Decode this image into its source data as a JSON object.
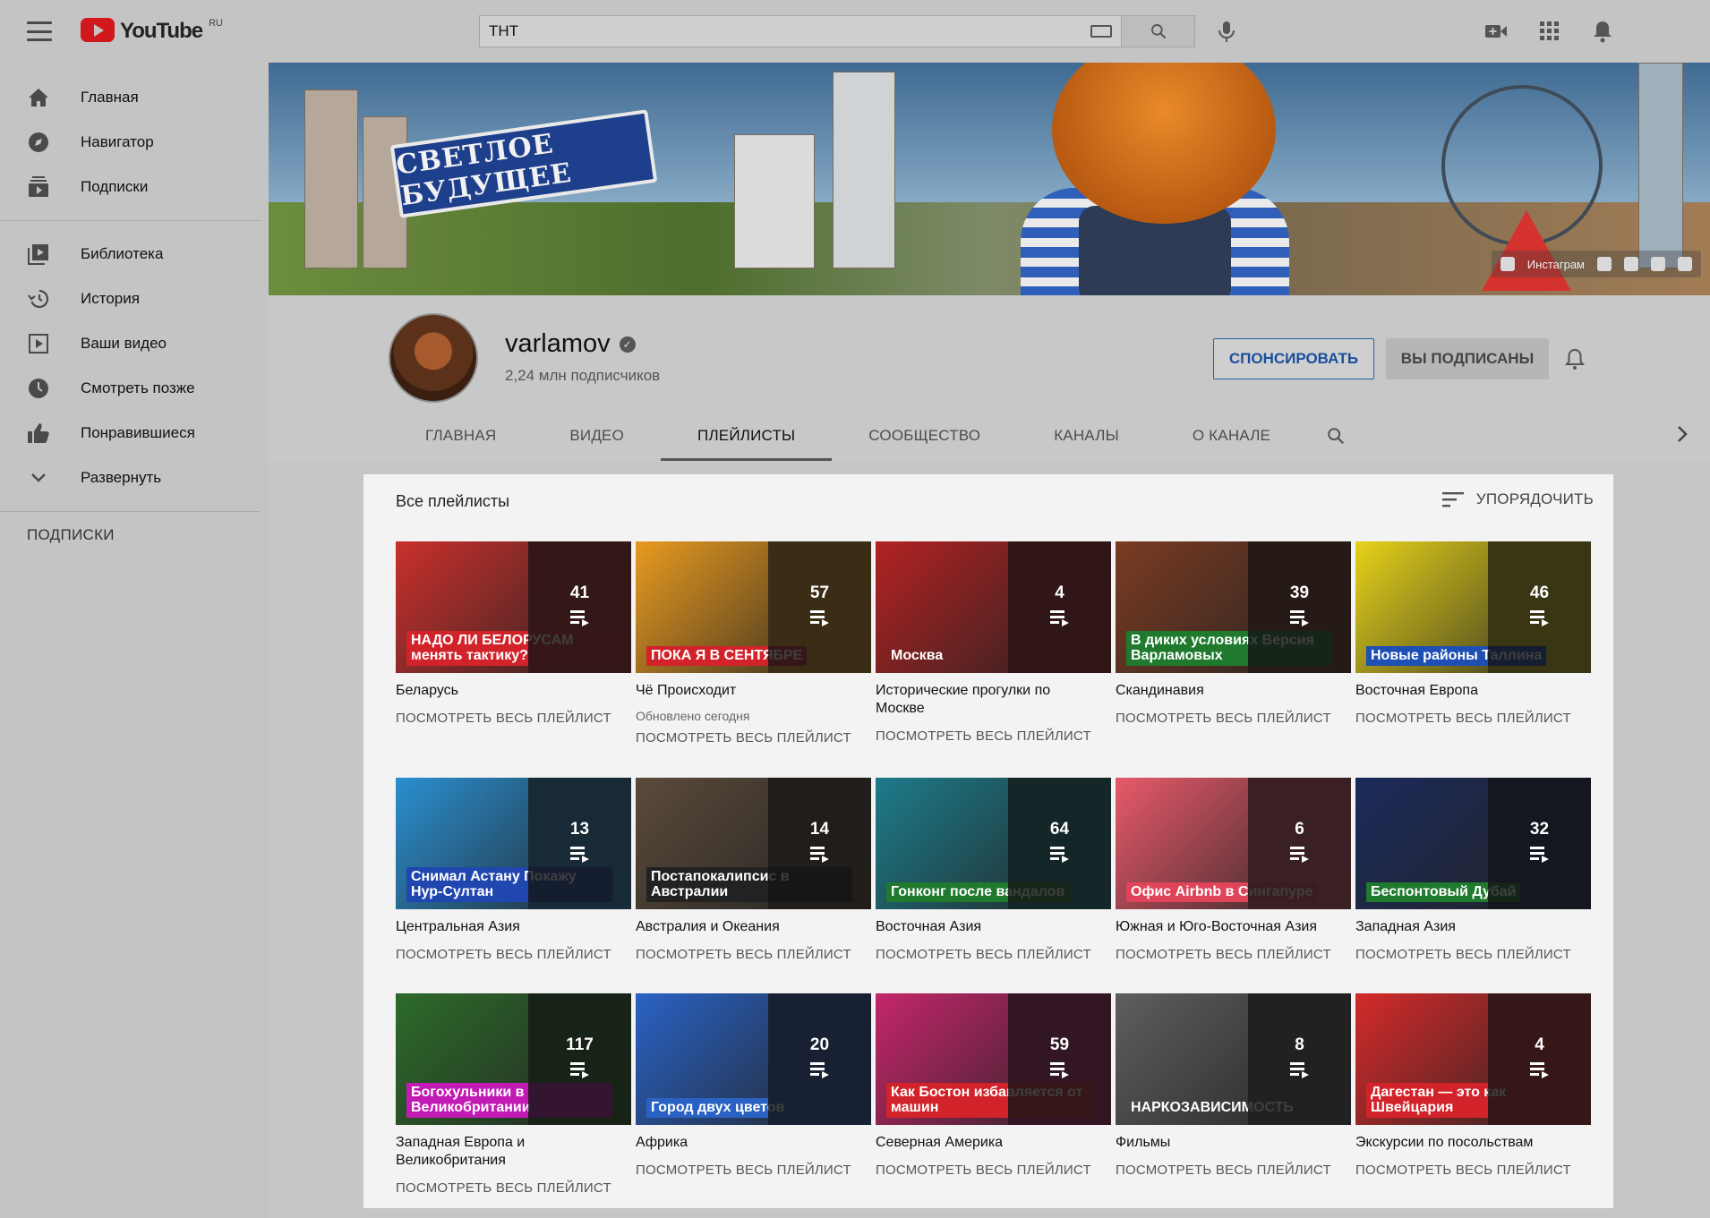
{
  "topbar": {
    "logo_text": "YouTube",
    "logo_region": "RU",
    "search_value": "ТНТ"
  },
  "sidebar": {
    "items": [
      {
        "label": "Главная",
        "icon": "home-icon"
      },
      {
        "label": "Навигатор",
        "icon": "compass-icon"
      },
      {
        "label": "Подписки",
        "icon": "subscriptions-icon"
      },
      {
        "label": "Библиотека",
        "icon": "library-icon"
      },
      {
        "label": "История",
        "icon": "history-icon"
      },
      {
        "label": "Ваши видео",
        "icon": "your-videos-icon"
      },
      {
        "label": "Смотреть позже",
        "icon": "clock-icon"
      },
      {
        "label": "Понравившиеся",
        "icon": "thumbs-up-icon"
      },
      {
        "label": "Развернуть",
        "icon": "chevron-down-icon"
      }
    ],
    "subscriptions_header": "ПОДПИСКИ"
  },
  "banner": {
    "sign_text": "СВЕТЛОЕ БУДУЩЕЕ",
    "social_label": "Инстаграм"
  },
  "channel": {
    "name": "varlamov",
    "subscribers": "2,24 млн подписчиков",
    "sponsor_label": "СПОНСИРОВАТЬ",
    "subscribed_label": "ВЫ ПОДПИСАНЫ",
    "tabs": [
      "ГЛАВНАЯ",
      "ВИДЕО",
      "ПЛЕЙЛИСТЫ",
      "СООБЩЕСТВО",
      "КАНАЛЫ",
      "О КАНАЛЕ"
    ],
    "active_tab": "ПЛЕЙЛИСТЫ"
  },
  "playlists": {
    "section_title": "Все плейлисты",
    "sort_label": "УПОРЯДОЧИТЬ",
    "view_all_label": "ПОСМОТРЕТЬ ВЕСЬ ПЛЕЙЛИСТ",
    "items": [
      {
        "title": "Беларусь",
        "count": "41",
        "caption": "НАДО ЛИ БЕЛОРУСАМ менять тактику?",
        "color": "#c9302c",
        "cap_bg": "#d3232a"
      },
      {
        "title": "Чё Происходит",
        "count": "57",
        "caption": "ПОКА Я В СЕНТЯБРЕ",
        "updated": "Обновлено сегодня",
        "color": "#e89a1f",
        "cap_bg": "#d3232a"
      },
      {
        "title": "Исторические прогулки по Москве",
        "count": "4",
        "caption": "Москва",
        "color": "#b22222",
        "cap_bg": ""
      },
      {
        "title": "Скандинавия",
        "count": "39",
        "caption": "В диких условиях Версия Варламовых",
        "color": "#7a3b22",
        "cap_bg": "#1f7a2e"
      },
      {
        "title": "Восточная Европа",
        "count": "46",
        "caption": "Новые районы Таллина",
        "color": "#e6d21a",
        "cap_bg": "#1e4fb3"
      },
      {
        "title": "Центральная Азия",
        "count": "13",
        "caption": "Снимал Астану Покажу Нур-Султан",
        "color": "#2a8fd0",
        "cap_bg": "#2047b0"
      },
      {
        "title": "Австралия и Океания",
        "count": "14",
        "caption": "Постапокалипсис в Австралии",
        "color": "#5a4a3a",
        "cap_bg": "#222222"
      },
      {
        "title": "Восточная Азия",
        "count": "64",
        "caption": "Гонконг после вандалов",
        "color": "#1d7b8a",
        "cap_bg": "#1f7a2e"
      },
      {
        "title": "Южная и Юго-Восточная Азия",
        "count": "6",
        "caption": "Офис Airbnb в Сингапуре",
        "color": "#e85a6a",
        "cap_bg": "#e0445a"
      },
      {
        "title": "Западная Азия",
        "count": "32",
        "caption": "Беспонтовый Дубай",
        "color": "#1c2a5a",
        "cap_bg": "#1f7a2e"
      },
      {
        "title": "Западная Европа и Великобритания",
        "count": "117",
        "caption": "Богохульники в Великобритании",
        "color": "#2d6b2a",
        "cap_bg": "#c21bb5"
      },
      {
        "title": "Африка",
        "count": "20",
        "caption": "Город двух цветов",
        "color": "#2a62c4",
        "cap_bg": "#2a62c4"
      },
      {
        "title": "Северная Америка",
        "count": "59",
        "caption": "Как Бостон избавляется от машин",
        "color": "#c4266a",
        "cap_bg": "#d3232a"
      },
      {
        "title": "Фильмы",
        "count": "8",
        "caption": "НАРКОЗАВИСИМОСТЬ",
        "color": "#5e5e5e",
        "cap_bg": ""
      },
      {
        "title": "Экскурсии по посольствам",
        "count": "4",
        "caption": "Дагестан — это как Швейцария",
        "color": "#d32a2a",
        "cap_bg": "#d3232a"
      }
    ]
  }
}
